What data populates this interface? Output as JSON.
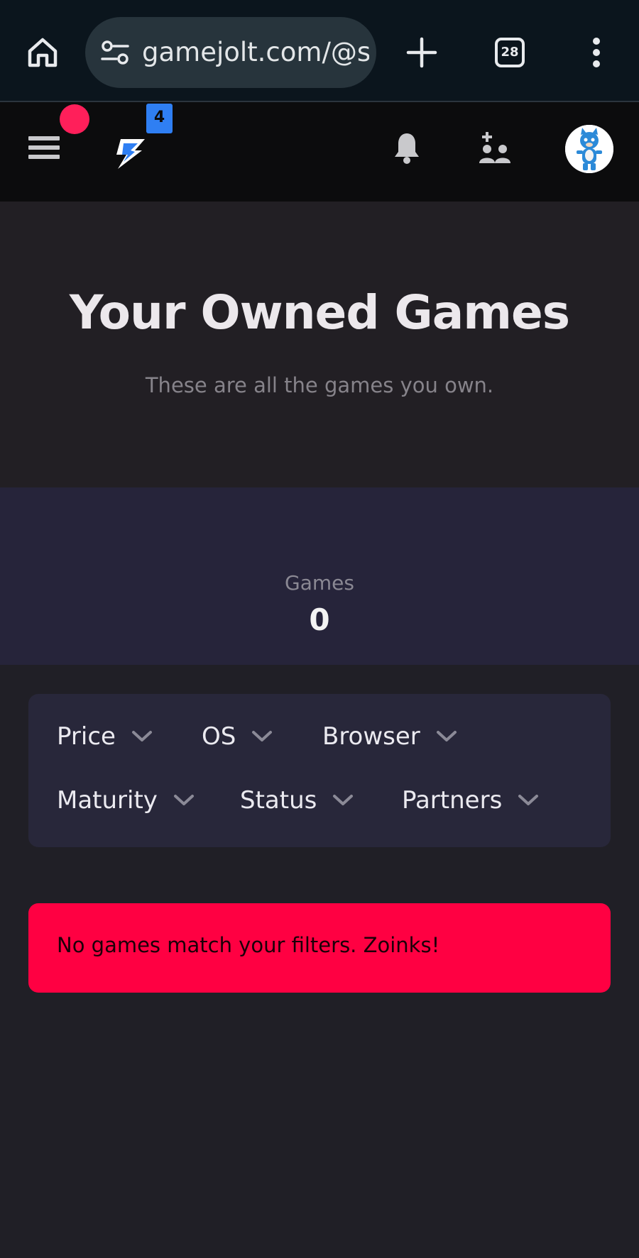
{
  "browser": {
    "url": "gamejolt.com/@s",
    "tab_count": "28",
    "icons": [
      "home-icon",
      "tune-icon",
      "plus-icon",
      "tabs-icon",
      "more-vert-icon"
    ]
  },
  "header": {
    "logo_badge": "4",
    "icons": [
      "menu-icon",
      "gamejolt-logo",
      "bell-icon",
      "friends-icon",
      "avatar"
    ],
    "colors": {
      "notification_dot": "#ff1f5a",
      "badge": "#2f7ff3"
    }
  },
  "hero": {
    "title": "Your Owned Games",
    "subtitle": "These are all the games you own."
  },
  "stats": {
    "label": "Games",
    "value": "0"
  },
  "filters": [
    {
      "label": "Price"
    },
    {
      "label": "OS"
    },
    {
      "label": "Browser"
    },
    {
      "label": "Maturity"
    },
    {
      "label": "Status"
    },
    {
      "label": "Partners"
    }
  ],
  "alert": {
    "message": "No games match your filters. Zoinks!",
    "color": "#ff0042"
  }
}
